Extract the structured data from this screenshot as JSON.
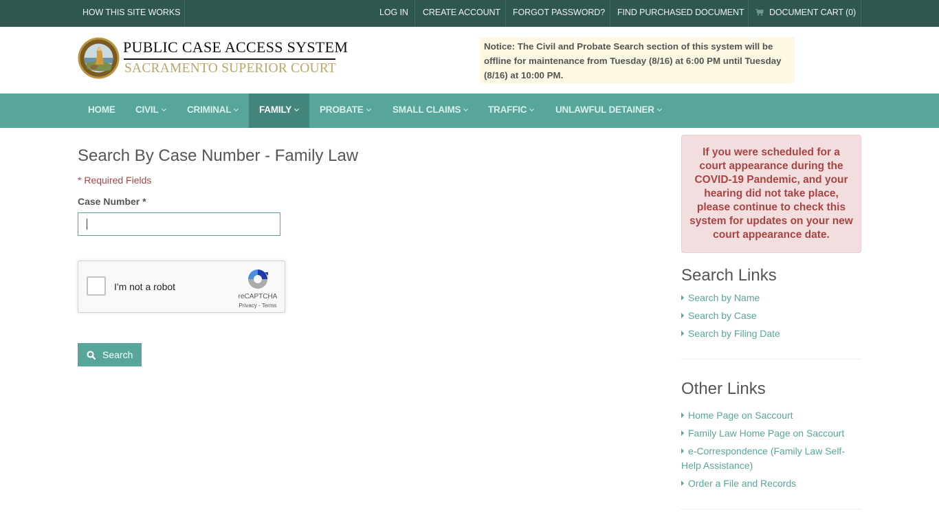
{
  "topbar": {
    "how_it_works": "HOW THIS SITE WORKS",
    "log_in": "LOG IN",
    "create_account": "CREATE ACCOUNT",
    "forgot_password": "FORGOT PASSWORD?",
    "find_purchased": "FIND PURCHASED DOCUMENT",
    "cart": "DOCUMENT CART (0)",
    "cart_icon": "shopping-cart-icon"
  },
  "header": {
    "title": "PUBLIC CASE ACCESS SYSTEM",
    "subtitle": "SACRAMENTO SUPERIOR COURT",
    "seal_icon": "court-seal-logo",
    "notice": "Notice: The Civil and Probate Search section of this system will be offline for maintenance from Tuesday (8/16) at 6:00 PM until Tuesday (8/16) at 10:00 PM."
  },
  "nav": {
    "items": [
      {
        "label": "HOME",
        "dropdown": false,
        "active": false
      },
      {
        "label": "CIVIL",
        "dropdown": true,
        "active": false
      },
      {
        "label": "CRIMINAL",
        "dropdown": true,
        "active": false
      },
      {
        "label": "FAMILY",
        "dropdown": true,
        "active": true
      },
      {
        "label": "PROBATE",
        "dropdown": true,
        "active": false
      },
      {
        "label": "SMALL CLAIMS",
        "dropdown": true,
        "active": false
      },
      {
        "label": "TRAFFIC",
        "dropdown": true,
        "active": false
      },
      {
        "label": "UNLAWFUL DETAINER",
        "dropdown": true,
        "active": false
      }
    ]
  },
  "main": {
    "title": "Search By Case Number - Family Law",
    "required_note": "* Required Fields",
    "case_number_label": "Case Number *",
    "case_number_value": "",
    "case_number_placeholder": "",
    "recaptcha": {
      "label": "I'm not a robot",
      "brand": "reCAPTCHA",
      "terms": "Privacy - Terms",
      "checked": false
    },
    "search_button": "Search"
  },
  "sidebar": {
    "covid_notice": "If you were scheduled for a court appearance during the COVID-19 Pandemic, and your hearing did not take place, please continue to check this system for updates on your new court appearance date.",
    "search_links_title": "Search Links",
    "search_links": [
      "Search by Name",
      "Search by Case",
      "Search by Filing Date"
    ],
    "other_links_title": "Other Links",
    "other_links": [
      "Home Page on Saccourt",
      "Family Law Home Page on Saccourt",
      "e-Correspondence (Family Law Self-Help Assistance)",
      "Order a File and Records"
    ]
  },
  "colors": {
    "topbar": "#2e5750",
    "nav": "#57a699",
    "nav_active": "#44867b",
    "accent": "#57a699",
    "notice_bg": "#fcf8e3",
    "alert_bg": "#f2dede",
    "alert_text": "#a94442"
  }
}
